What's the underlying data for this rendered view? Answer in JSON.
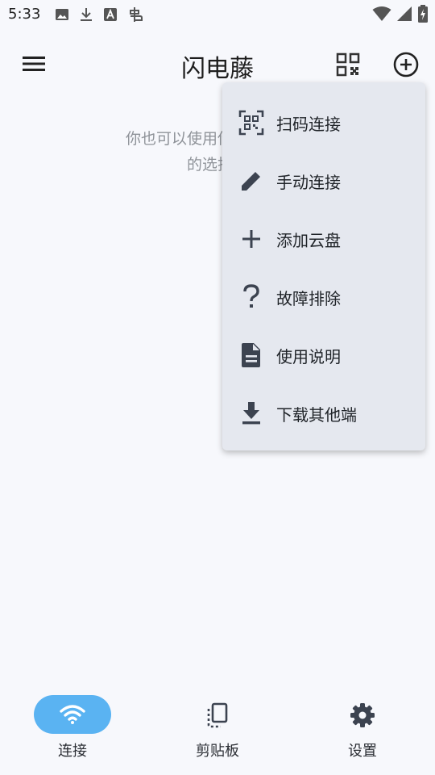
{
  "status_bar": {
    "time": "5:33",
    "left_icons": [
      "image-icon",
      "download-icon",
      "text-a-icon",
      "bug-icon"
    ],
    "right_icons": [
      "wifi-icon",
      "signal-icon",
      "battery-charging-icon"
    ]
  },
  "app_bar": {
    "title": "闪电藤",
    "menu_icon": "hamburger-menu-icon",
    "qr_icon": "qr-code-icon",
    "add_icon": "add-circle-icon"
  },
  "main": {
    "hint_line1": "你也可以使用你的移动设备",
    "hint_line2": "的选择文"
  },
  "dropdown_menu": {
    "items": [
      {
        "label": "扫码连接",
        "icon": "qr-scan-icon"
      },
      {
        "label": "手动连接",
        "icon": "pencil-icon"
      },
      {
        "label": "添加云盘",
        "icon": "plus-icon"
      },
      {
        "label": "故障排除",
        "icon": "question-icon"
      },
      {
        "label": "使用说明",
        "icon": "document-icon"
      },
      {
        "label": "下载其他端",
        "icon": "download-icon"
      }
    ]
  },
  "bottom_nav": {
    "items": [
      {
        "label": "连接",
        "icon": "wifi-icon",
        "active": true
      },
      {
        "label": "剪贴板",
        "icon": "clipboard-copy-icon",
        "active": false
      },
      {
        "label": "设置",
        "icon": "gear-icon",
        "active": false
      }
    ]
  },
  "colors": {
    "background": "#f7f8fc",
    "menu_background": "#e5e8ef",
    "active_pill": "#5ab3f2",
    "hint_text": "#8f9399",
    "icon_gray": "#3c4350"
  }
}
